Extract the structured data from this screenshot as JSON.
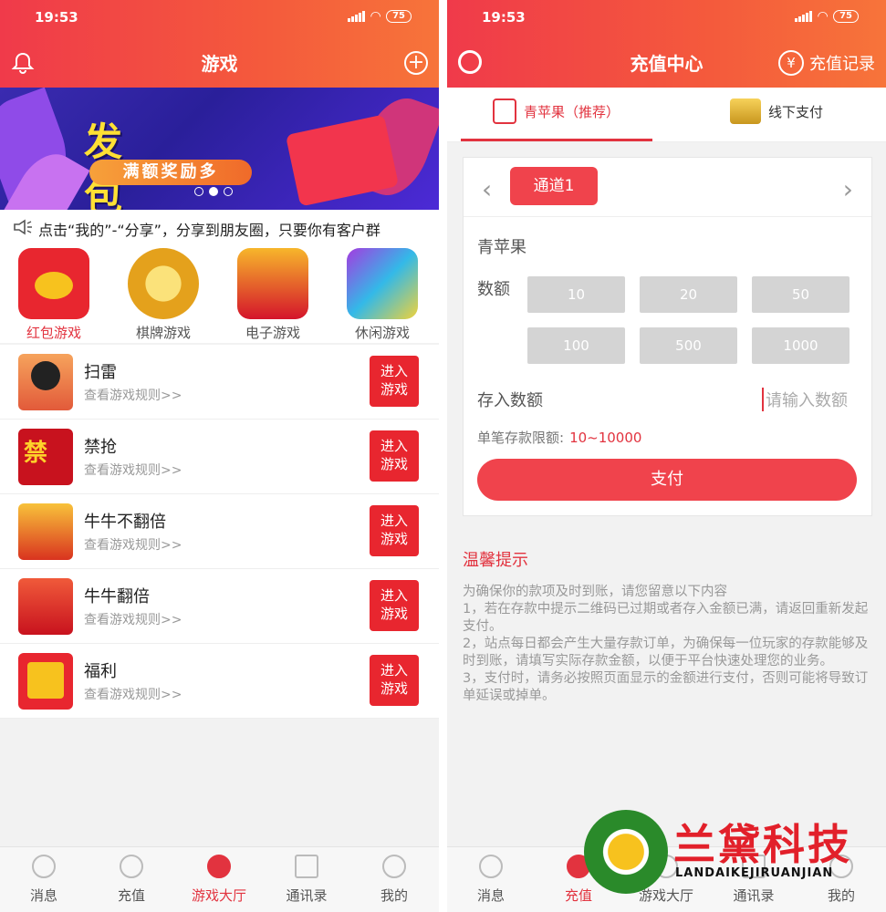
{
  "status": {
    "time": "19:53",
    "battery": "75"
  },
  "left": {
    "title": "游戏",
    "banner": {
      "headline": "发包抢包",
      "tagline": "满额奖励多"
    },
    "notice": "点击“我的”-“分享”，分享到朋友圈，只要你有客户群",
    "categories": [
      {
        "label": "红包游戏",
        "active": true
      },
      {
        "label": "棋牌游戏"
      },
      {
        "label": "电子游戏"
      },
      {
        "label": "休闲游戏"
      }
    ],
    "games": [
      {
        "name": "扫雷",
        "rules": "查看游戏规则>>",
        "enter": "进入\n游戏"
      },
      {
        "name": "禁抢",
        "rules": "查看游戏规则>>",
        "enter": "进入\n游戏"
      },
      {
        "name": "牛牛不翻倍",
        "rules": "查看游戏规则>>",
        "enter": "进入\n游戏"
      },
      {
        "name": "牛牛翻倍",
        "rules": "查看游戏规则>>",
        "enter": "进入\n游戏"
      },
      {
        "name": "福利",
        "rules": "查看游戏规则>>",
        "enter": "进入\n游戏"
      }
    ],
    "tabs": [
      "消息",
      "充值",
      "游戏大厅",
      "通讯录",
      "我的"
    ],
    "active_tab": "游戏大厅"
  },
  "right": {
    "title": "充值中心",
    "record": "充值记录",
    "pay_tabs": [
      {
        "label": "青苹果（推荐）",
        "active": true
      },
      {
        "label": "线下支付"
      }
    ],
    "channel": "通道1",
    "product": "青苹果",
    "amount_label": "数额",
    "amounts": [
      "10",
      "20",
      "50",
      "100",
      "500",
      "1000"
    ],
    "deposit_label": "存入数额",
    "deposit_placeholder": "请输入数额",
    "limit_label": "单笔存款限额:",
    "limit_value": "10~10000",
    "pay_button": "支付",
    "tips_title": "温馨提示",
    "tips": [
      "为确保你的款项及时到账，请您留意以下内容",
      "1，若在存款中提示二维码已过期或者存入金额已满，请返回重新发起支付。",
      "2，站点每日都会产生大量存款订单，为确保每一位玩家的存款能够及时到账，请填写实际存款金额，以便于平台快速处理您的业务。",
      "3，支付时，请务必按照页面显示的金额进行支付，否则可能将导致订单延误或掉单。"
    ],
    "tabs": [
      "消息",
      "充值",
      "游戏大厅",
      "通讯录",
      "我的"
    ],
    "active_tab": "充值"
  },
  "watermark": {
    "cn": "兰黛科技",
    "en": "LANDAIKEJIRUANJIAN"
  },
  "colors": {
    "primary": "#e2333f",
    "header_start": "#f03a4a",
    "header_end": "#f7743a"
  }
}
